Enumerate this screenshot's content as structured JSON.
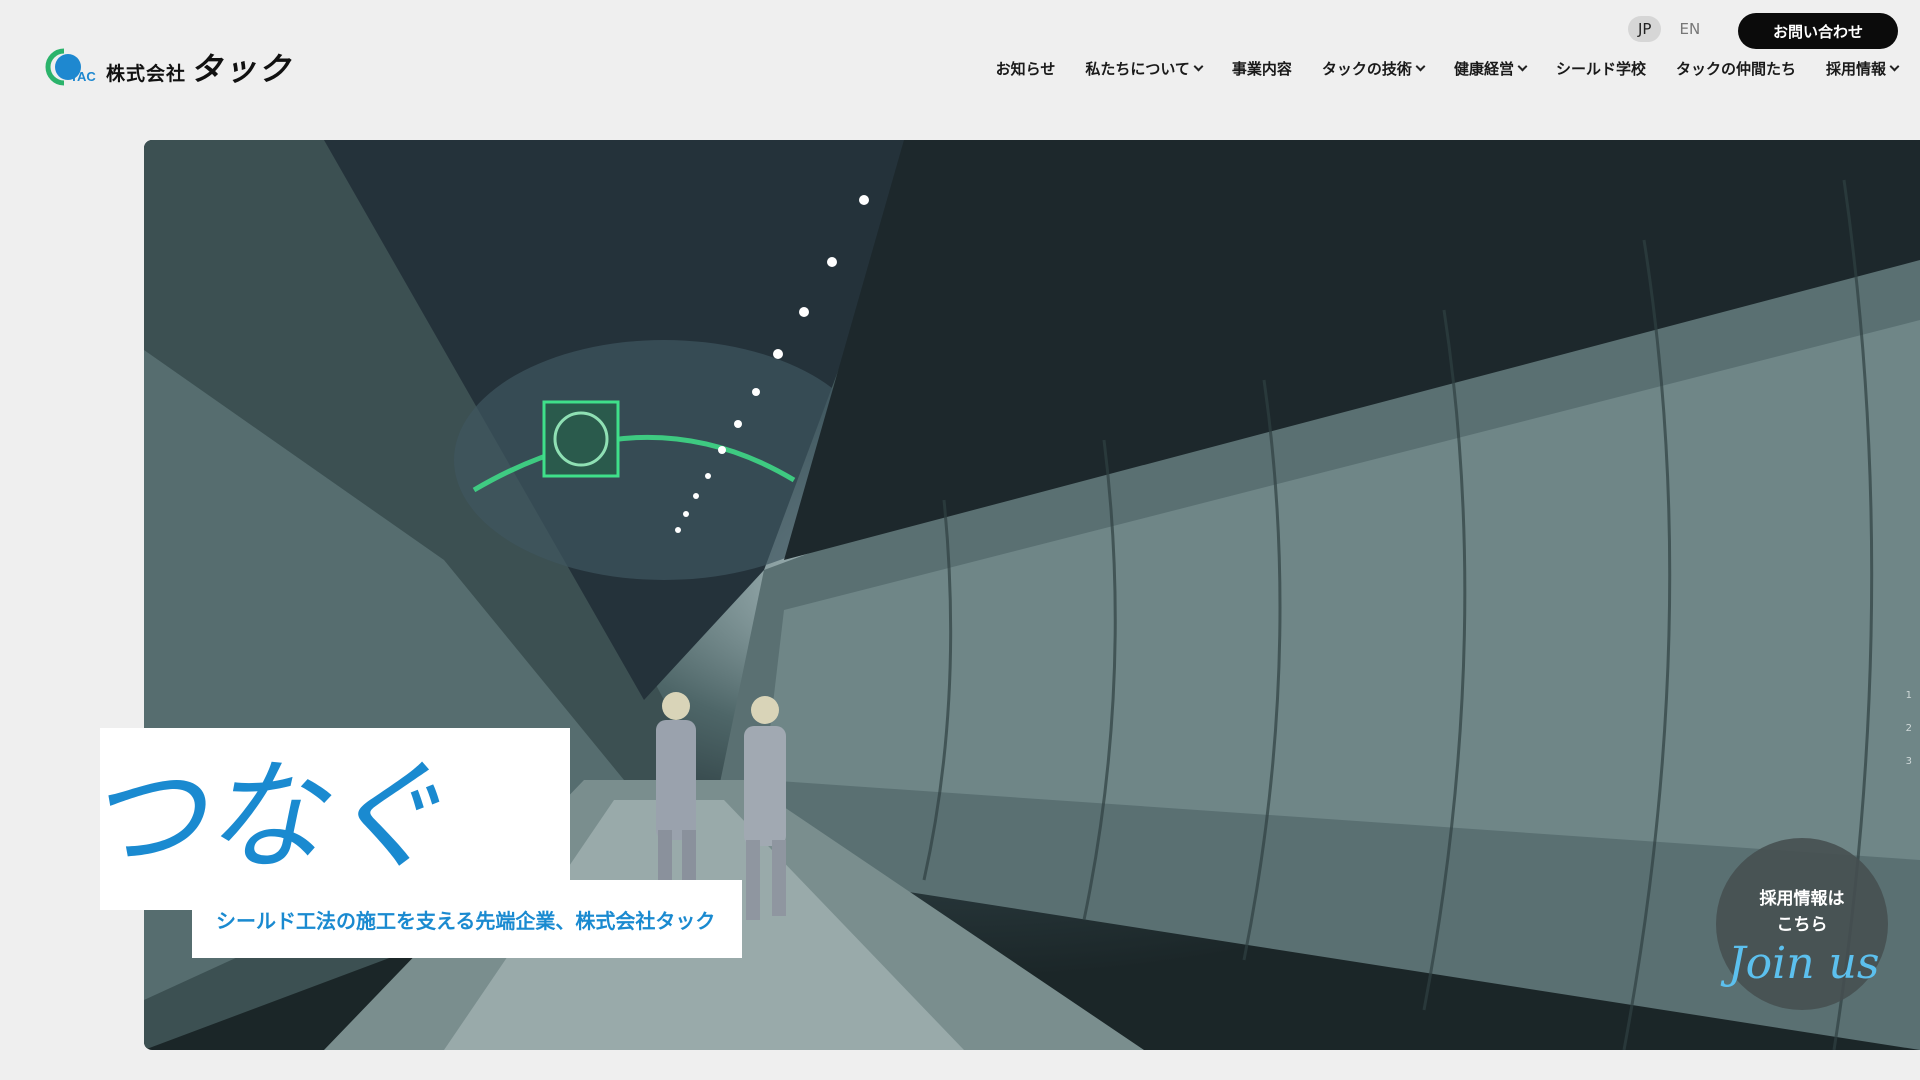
{
  "header": {
    "logo": {
      "mark": "TAC",
      "company": "株式会社",
      "name": "タック"
    },
    "lang": {
      "jp": "JP",
      "en": "EN"
    },
    "contact_label": "お問い合わせ",
    "nav": [
      {
        "label": "お知らせ",
        "dropdown": false
      },
      {
        "label": "私たちについて",
        "dropdown": true
      },
      {
        "label": "事業内容",
        "dropdown": false
      },
      {
        "label": "タックの技術",
        "dropdown": true
      },
      {
        "label": "健康経営",
        "dropdown": true
      },
      {
        "label": "シールド学校",
        "dropdown": false
      },
      {
        "label": "タックの仲間たち",
        "dropdown": false
      },
      {
        "label": "採用情報",
        "dropdown": true
      }
    ]
  },
  "hero": {
    "catch": "つなぐ",
    "tagline": "シールド工法の施工を支える先端企業、株式会社タック",
    "slide_indicators": [
      "1",
      "2",
      "3"
    ],
    "join": {
      "text_line1": "採用情報は",
      "text_line2": "こちら",
      "script": "Join us"
    }
  },
  "colors": {
    "accent": "#1a8ad0",
    "logo_green": "#2bb36b",
    "logo_blue": "#1e88d0",
    "contact_bg": "#0b0b0b"
  }
}
